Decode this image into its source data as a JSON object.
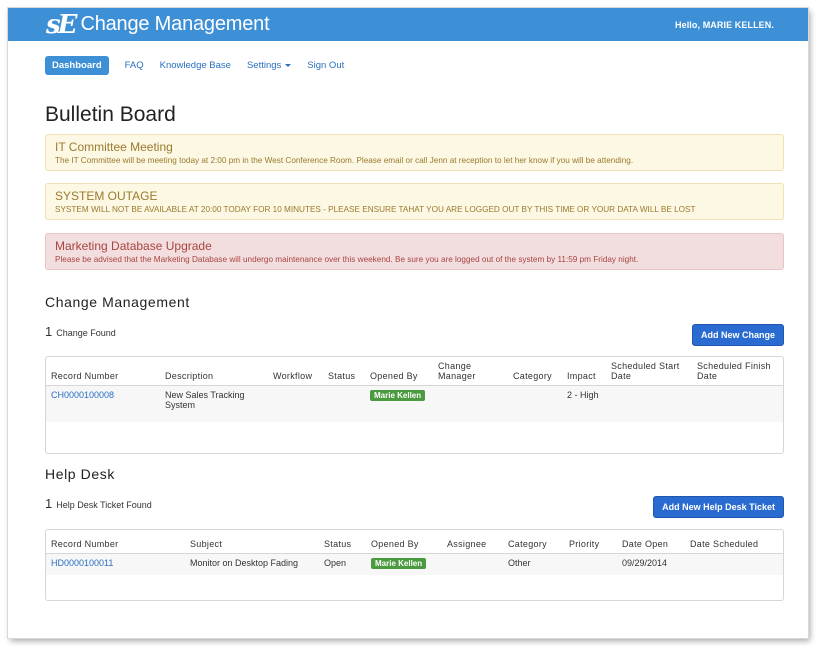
{
  "header": {
    "logo": "sE",
    "title": "Change Management",
    "greeting": "Hello, MARIE KELLEN."
  },
  "nav": {
    "dashboard": "Dashboard",
    "faq": "FAQ",
    "knowledge_base": "Knowledge Base",
    "settings": "Settings",
    "sign_out": "Sign Out"
  },
  "page_title": "Bulletin Board",
  "alerts": [
    {
      "title": "IT Committee Meeting",
      "body": "The IT Committee will be meeting today at 2:00 pm in the West Conference Room. Please email or call Jenn at reception to let her know if you will be attending."
    },
    {
      "title": "SYSTEM OUTAGE",
      "body": "SYSTEM WILL NOT BE AVAILABLE AT 20:00 TODAY FOR 10 MINUTES - PLEASE ENSURE TAHAT YOU ARE LOGGED OUT BY THIS TIME OR YOUR DATA WILL BE LOST"
    },
    {
      "title": "Marketing Database Upgrade",
      "body": "Please be advised that the Marketing Database will undergo maintenance over this weekend. Be sure you are logged out of the system by 11:59 pm Friday night."
    }
  ],
  "colors": {
    "brand": "#3d8fd6",
    "primary_button": "#2a6bd1",
    "badge_green": "#4a9a3f",
    "warning_bg": "#fcf8e3",
    "danger_bg": "#f2dede"
  },
  "change": {
    "section_title": "Change Management",
    "count": "1",
    "count_label": "Change Found",
    "add_button": "Add New Change",
    "columns": {
      "record_number": "Record Number",
      "description": "Description",
      "workflow": "Workflow",
      "status": "Status",
      "opened_by": "Opened By",
      "change_manager": "Change Manager",
      "category": "Category",
      "impact": "Impact",
      "scheduled_start": "Scheduled Start Date",
      "scheduled_finish": "Scheduled Finish Date"
    },
    "rows": [
      {
        "record_number": "CH0000100008",
        "description": "New Sales Tracking System",
        "workflow": "",
        "status": "",
        "opened_by": "Marie Kellen",
        "change_manager": "",
        "category": "",
        "impact": "2 - High",
        "scheduled_start": "",
        "scheduled_finish": ""
      }
    ]
  },
  "helpdesk": {
    "section_title": "Help Desk",
    "count": "1",
    "count_label": "Help Desk Ticket Found",
    "add_button": "Add New Help Desk Ticket",
    "columns": {
      "record_number": "Record Number",
      "subject": "Subject",
      "status": "Status",
      "opened_by": "Opened By",
      "assignee": "Assignee",
      "category": "Category",
      "priority": "Priority",
      "date_open": "Date Open",
      "date_scheduled": "Date Scheduled"
    },
    "rows": [
      {
        "record_number": "HD0000100011",
        "subject": "Monitor on Desktop Fading",
        "status": "Open",
        "opened_by": "Marie Kellen",
        "assignee": "",
        "category": "Other",
        "priority": "",
        "date_open": "09/29/2014",
        "date_scheduled": ""
      }
    ]
  }
}
